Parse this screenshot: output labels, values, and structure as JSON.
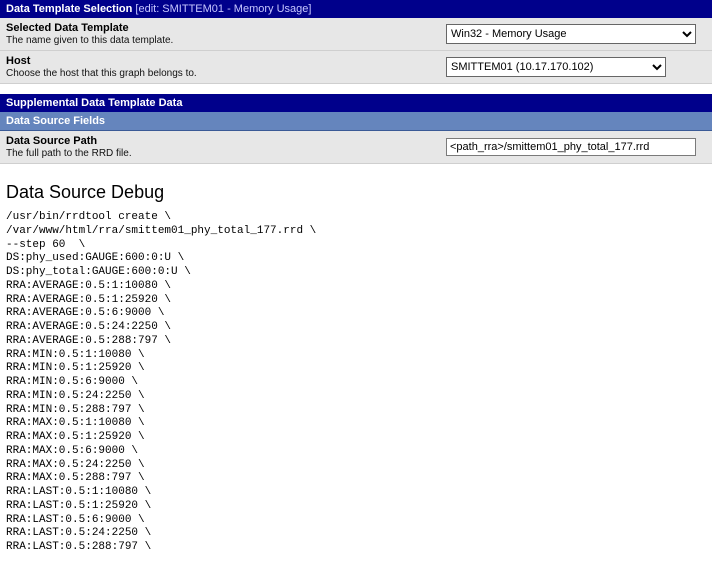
{
  "section1": {
    "title_prefix": "Data Template Selection",
    "title_edit": " [edit: SMITTEM01 - Memory Usage]",
    "rows": [
      {
        "label": "Selected Data Template",
        "desc": "The name given to this data template.",
        "value": "Win32 - Memory Usage"
      },
      {
        "label": "Host",
        "desc": "Choose the host that this graph belongs to.",
        "value": "SMITTEM01 (10.17.170.102)"
      }
    ]
  },
  "section2": {
    "title": "Supplemental Data Template Data",
    "sub_title": "Data Source Fields",
    "rows": [
      {
        "label": "Data Source Path",
        "desc": "The full path to the RRD file.",
        "value": "<path_rra>/smittem01_phy_total_177.rrd"
      }
    ]
  },
  "debug": {
    "title": "Data Source Debug",
    "text": "/usr/bin/rrdtool create \\\n/var/www/html/rra/smittem01_phy_total_177.rrd \\\n--step 60  \\\nDS:phy_used:GAUGE:600:0:U \\\nDS:phy_total:GAUGE:600:0:U \\\nRRA:AVERAGE:0.5:1:10080 \\\nRRA:AVERAGE:0.5:1:25920 \\\nRRA:AVERAGE:0.5:6:9000 \\\nRRA:AVERAGE:0.5:24:2250 \\\nRRA:AVERAGE:0.5:288:797 \\\nRRA:MIN:0.5:1:10080 \\\nRRA:MIN:0.5:1:25920 \\\nRRA:MIN:0.5:6:9000 \\\nRRA:MIN:0.5:24:2250 \\\nRRA:MIN:0.5:288:797 \\\nRRA:MAX:0.5:1:10080 \\\nRRA:MAX:0.5:1:25920 \\\nRRA:MAX:0.5:6:9000 \\\nRRA:MAX:0.5:24:2250 \\\nRRA:MAX:0.5:288:797 \\\nRRA:LAST:0.5:1:10080 \\\nRRA:LAST:0.5:1:25920 \\\nRRA:LAST:0.5:6:9000 \\\nRRA:LAST:0.5:24:2250 \\\nRRA:LAST:0.5:288:797 \\"
  }
}
